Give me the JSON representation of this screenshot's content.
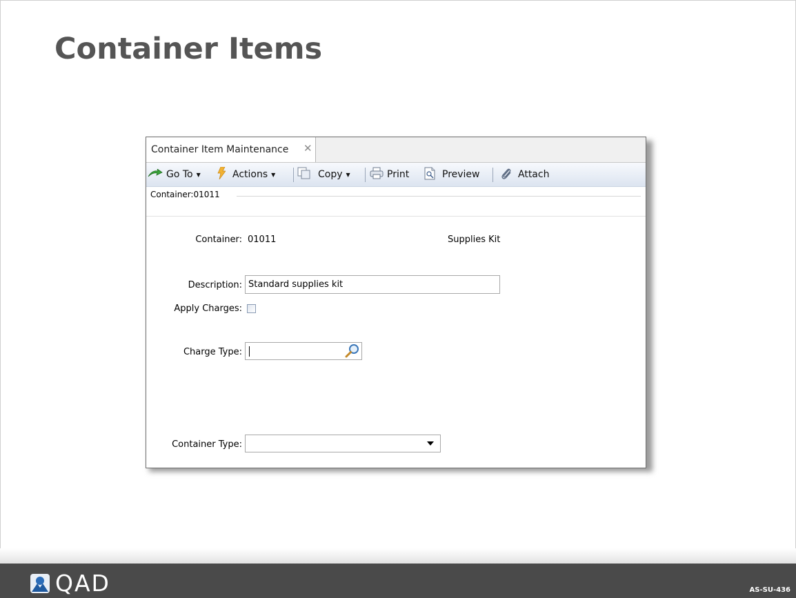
{
  "slide": {
    "title": "Container Items",
    "logo_text": "QAD",
    "slide_code": "AS-SU-436"
  },
  "app": {
    "tab_title": "Container Item Maintenance",
    "tab_close_symbol": "✕",
    "toolbar": {
      "goto_label": "Go To",
      "actions_label": "Actions",
      "copy_label": "Copy",
      "print_label": "Print",
      "preview_label": "Preview",
      "attach_label": "Attach"
    },
    "path_label": "Container:01011",
    "form": {
      "container_label": "Container:",
      "container_value": "01011",
      "container_desc": "Supplies Kit",
      "description_label": "Description:",
      "description_value": "Standard supplies kit",
      "apply_charges_label": "Apply Charges:",
      "apply_charges_checked": false,
      "charge_type_label": "Charge Type:",
      "charge_type_value": "",
      "container_type_label": "Container Type:",
      "container_type_value": ""
    }
  },
  "colors": {
    "title": "#555555",
    "footer": "#4a4a4a",
    "toolbar_gradient_top": "#f7f9fd",
    "toolbar_gradient_bottom": "#dce4f0"
  },
  "icons": {
    "goto": "green-arrow-icon",
    "actions": "lightning-icon",
    "copy": "copy-pages-icon",
    "print": "printer-icon",
    "preview": "preview-document-icon",
    "attach": "paperclip-icon",
    "lookup": "magnifier-icon",
    "dropdown": "chevron-down-icon",
    "logo": "qad-logo-icon"
  }
}
